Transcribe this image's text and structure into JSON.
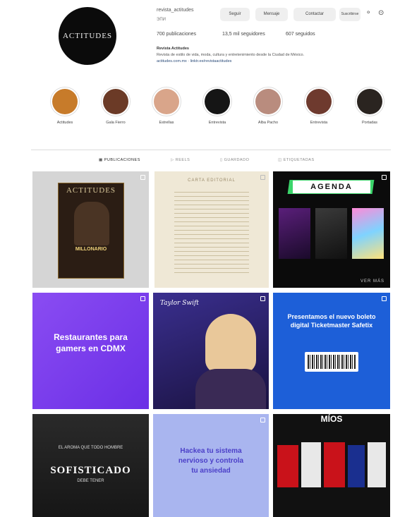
{
  "profile": {
    "avatar_text": "ACTITUDES",
    "username": "revista_actitudes",
    "subname": "ЭПИ",
    "buttons": [
      "Seguir",
      "Mensaje",
      "Contactar",
      "Suscribirse"
    ],
    "stats": [
      "700 publicaciones",
      "13,5 mil seguidores",
      "607 seguidos"
    ],
    "bio": {
      "name": "Revista Actitudes",
      "line1": "Revista de estilo de vida, moda, cultura y entretenimiento desde la Ciudad de México.",
      "link": "actitudes.com.mx · linktr.ee/revistaactitudes"
    },
    "icons": [
      "user-plus-icon",
      "more-icon"
    ]
  },
  "highlights": [
    {
      "label": "Actitudes",
      "color": "#c77b2a"
    },
    {
      "label": "Gala Fierro",
      "color": "#6b3a26"
    },
    {
      "label": "Estrellas",
      "color": "#d9a58a"
    },
    {
      "label": "Entrevista",
      "color": "#151515"
    },
    {
      "label": "Alba Pacho",
      "color": "#b98c7e"
    },
    {
      "label": "Entrevista",
      "color": "#6e3a2e"
    },
    {
      "label": "Portadas",
      "color": "#2a2420"
    }
  ],
  "tabs": [
    {
      "label": "PUBLICACIONES",
      "active": true
    },
    {
      "label": "REELS",
      "active": false
    },
    {
      "label": "GUARDADO",
      "active": false
    },
    {
      "label": "ETIQUETADAS",
      "active": false
    }
  ],
  "posts": {
    "cover_title": "ACTITUDES",
    "cover_tag": "MILLONARIO",
    "letter_title": "CARTA EDITORIAL",
    "agenda_title": "AGENDA",
    "agenda_more": "VER MÁS",
    "restaurants_text": "Restaurantes para gamers en CDMX",
    "concert_sign": "Taylor Swift",
    "ticket_text": "Presentamos el nuevo boleto digital Ticketmaster Safetix",
    "luxury_small": "EL AROMA QUE TODO HOMBRE",
    "luxury_big": "SOFISTICADO",
    "luxury_small2": "DEBE TENER",
    "nervous_text": "Hackea tu sistema nervioso y controla tu ansiedad",
    "sign_text": "MÍOS"
  },
  "colors": {
    "purple": "#7b3df0",
    "blue_purple": "#4f3ed4",
    "ticket_blue": "#1d5fd8",
    "dark": "#1f1f1f",
    "lavender": "#a9b5ef"
  }
}
